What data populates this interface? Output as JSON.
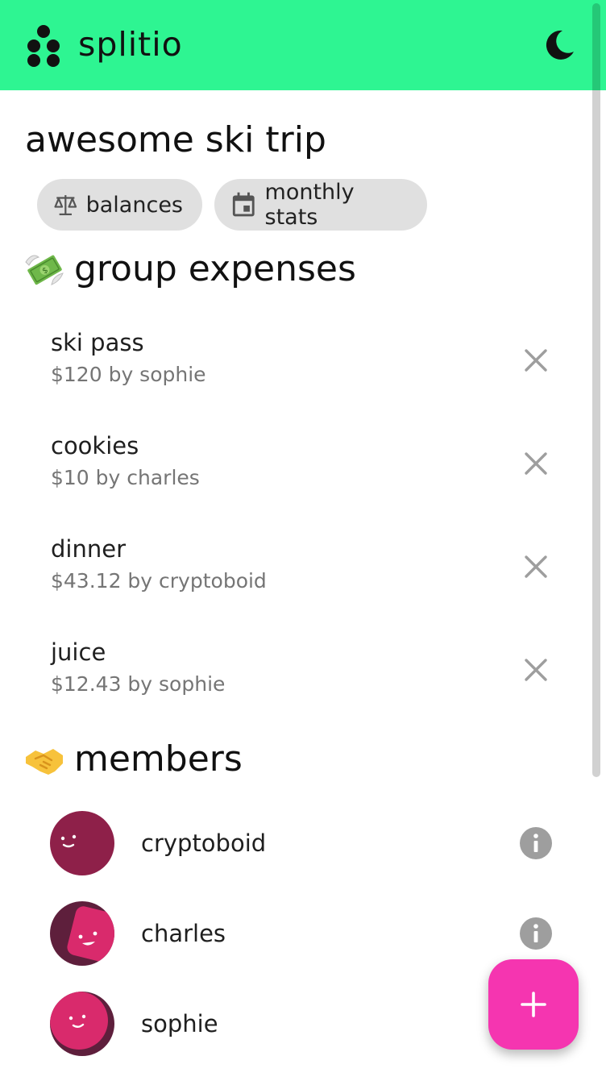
{
  "colors": {
    "appbar": "#2ef592",
    "fab": "#f535b0",
    "avatar_primary": "#8e2049",
    "avatar_accent": "#d92a6c",
    "icon_grey": "#9e9e9e"
  },
  "header": {
    "brand": "splitio",
    "theme_icon": "moon-icon"
  },
  "group": {
    "title": "awesome ski trip",
    "chips": [
      {
        "label": "balances",
        "icon": "scale-icon"
      },
      {
        "label": "monthly stats",
        "icon": "calendar-icon"
      }
    ]
  },
  "expenses": {
    "title": "group expenses",
    "icon": "money-with-wings-icon",
    "items": [
      {
        "name": "ski pass",
        "detail": "$120 by sophie"
      },
      {
        "name": "cookies",
        "detail": "$10 by charles"
      },
      {
        "name": "dinner",
        "detail": "$43.12 by cryptoboid"
      },
      {
        "name": "juice",
        "detail": "$12.43 by sophie"
      }
    ]
  },
  "members": {
    "title": "members",
    "icon": "handshake-icon",
    "items": [
      {
        "name": "cryptoboid"
      },
      {
        "name": "charles"
      },
      {
        "name": "sophie"
      }
    ]
  },
  "fab": {
    "icon": "plus-icon"
  }
}
